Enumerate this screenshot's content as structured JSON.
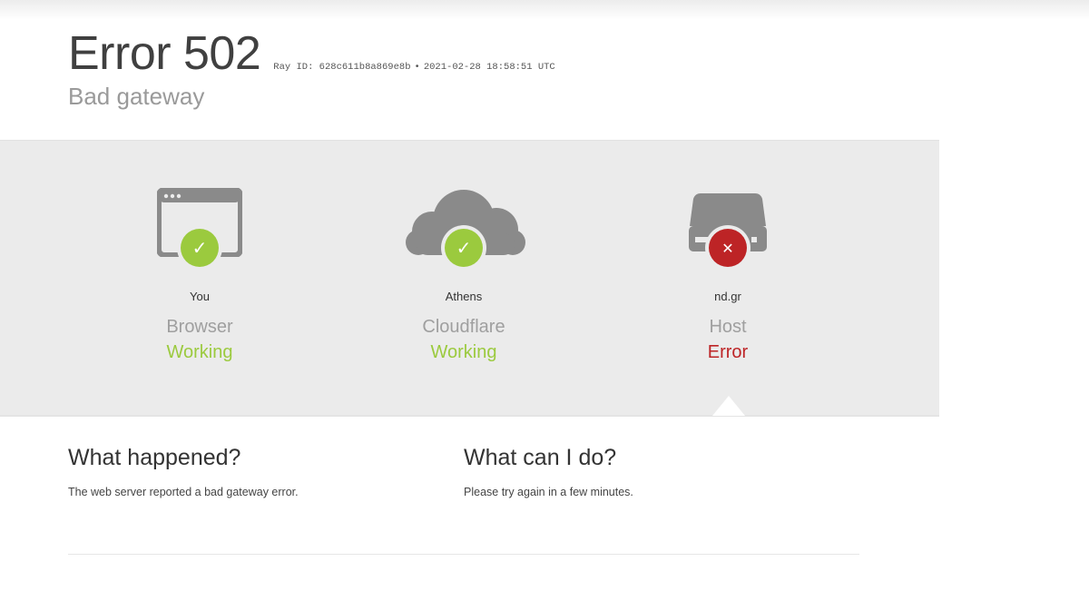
{
  "header": {
    "title": "Error 502",
    "ray_label": "Ray ID: 628c611b8a869e8b",
    "separator": "•",
    "timestamp": "2021-02-28 18:58:51 UTC",
    "subtitle": "Bad gateway"
  },
  "nodes": [
    {
      "icon": "browser-window-icon",
      "place": "You",
      "name": "Browser",
      "status": "Working",
      "state": "ok"
    },
    {
      "icon": "cloud-icon",
      "place": "Athens",
      "name": "Cloudflare",
      "status": "Working",
      "state": "ok"
    },
    {
      "icon": "server-icon",
      "place": "nd.gr",
      "name": "Host",
      "status": "Error",
      "state": "error"
    }
  ],
  "badges": {
    "ok": "✓",
    "error": "✕"
  },
  "info": {
    "what_happened_title": "What happened?",
    "what_happened_text": "The web server reported a bad gateway error.",
    "what_can_i_do_title": "What can I do?",
    "what_can_i_do_text": "Please try again in a few minutes."
  },
  "colors": {
    "working": "#9bca3e",
    "error": "#bd2426",
    "band": "#ebebeb",
    "icon_gray": "#8a8a8a"
  }
}
